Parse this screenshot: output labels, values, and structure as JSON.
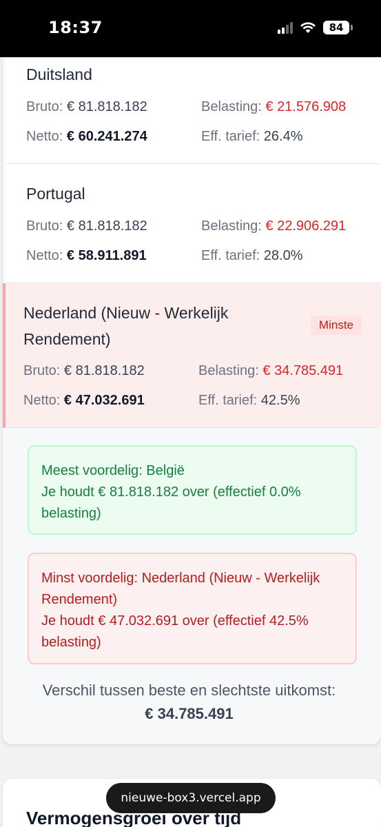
{
  "status_bar": {
    "time": "18:37",
    "battery": "84"
  },
  "labels": {
    "bruto": "Bruto: ",
    "netto": "Netto: ",
    "belasting": "Belasting: ",
    "eff_tarief": "Eff. tarief: "
  },
  "countries": [
    {
      "name": "Duitsland",
      "bruto": "€ 81.818.182",
      "netto": "€ 60.241.274",
      "belasting": "€ 21.576.908",
      "eff": "26.4%"
    },
    {
      "name": "Portugal",
      "bruto": "€ 81.818.182",
      "netto": "€ 58.911.891",
      "belasting": "€ 22.906.291",
      "eff": "28.0%"
    },
    {
      "name_line1": "Nederland (Nieuw - Werkelijk",
      "name_line2": "Rendement)",
      "badge": "Minste",
      "bruto": "€ 81.818.182",
      "netto": "€ 47.032.691",
      "belasting": "€ 34.785.491",
      "eff": "42.5%"
    }
  ],
  "best": {
    "line1": "Meest voordelig: België",
    "line2": "Je houdt € 81.818.182 over (effectief 0.0%",
    "line3": "belasting)"
  },
  "worst": {
    "line1": "Minst voordelig: Nederland (Nieuw - Werkelijk",
    "line2": "Rendement)",
    "line3": "Je houdt € 47.032.691 over (effectief 42.5%",
    "line4": "belasting)"
  },
  "difference": {
    "label": "Verschil tussen beste en slechtste uitkomst:",
    "amount": "€ 34.785.491"
  },
  "next_section": {
    "title": "Vermogensgroei over tijd"
  },
  "url_bar": {
    "url": "nieuwe-box3.vercel.app"
  },
  "colors": {
    "red": "#dc2626",
    "green": "#15803d",
    "highlight": "#fdeeee"
  }
}
